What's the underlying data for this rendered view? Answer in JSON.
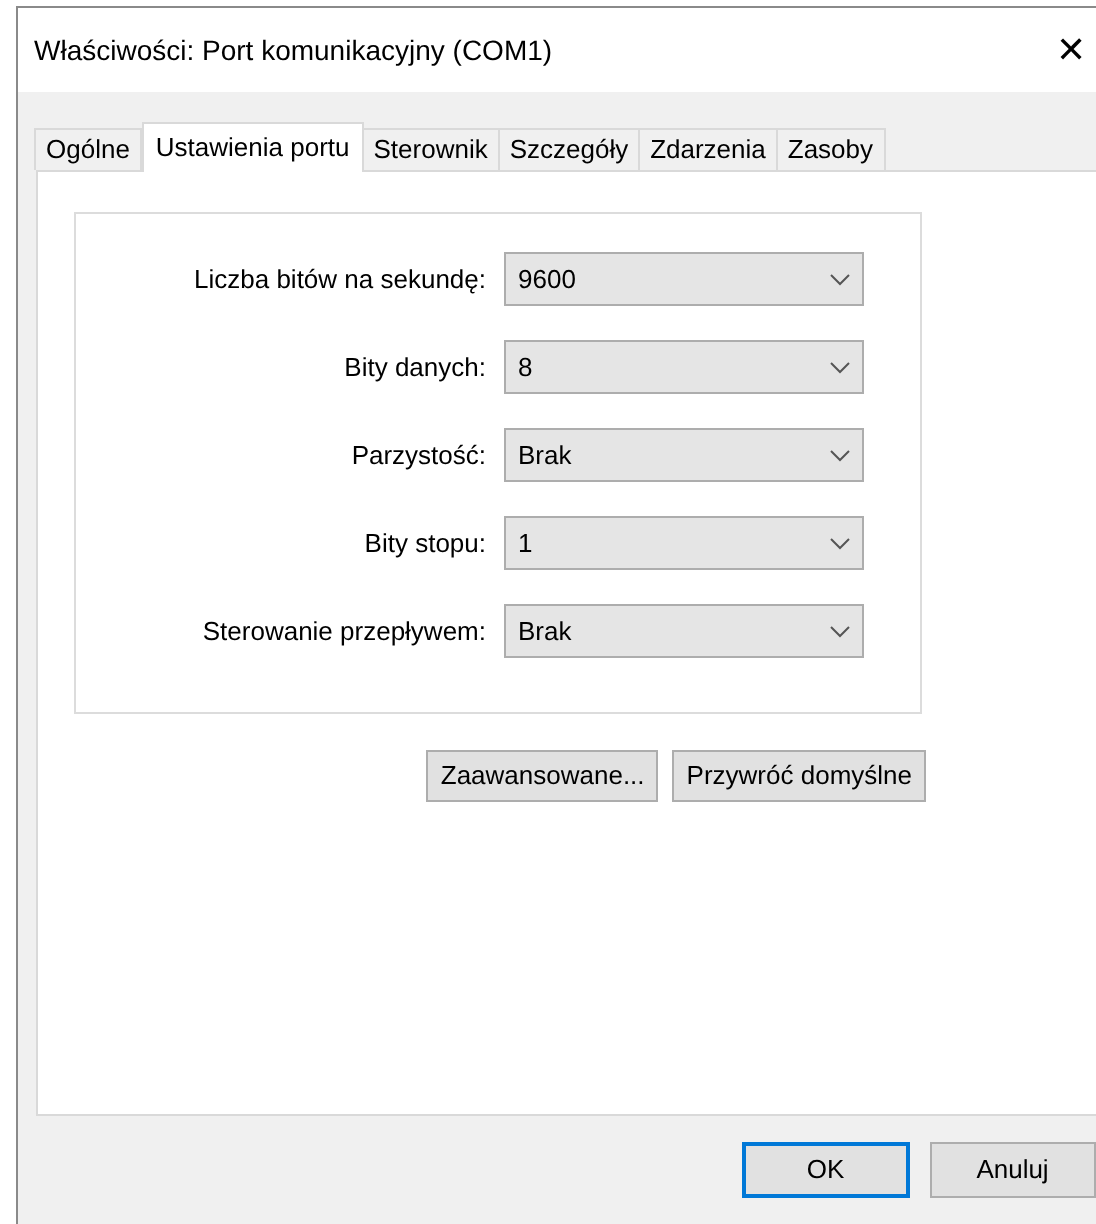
{
  "window": {
    "title": "Właściwości: Port komunikacyjny (COM1)",
    "close": "✕"
  },
  "tabs": [
    {
      "label": "Ogólne",
      "selected": false
    },
    {
      "label": "Ustawienia portu",
      "selected": true
    },
    {
      "label": "Sterownik",
      "selected": false
    },
    {
      "label": "Szczegóły",
      "selected": false
    },
    {
      "label": "Zdarzenia",
      "selected": false
    },
    {
      "label": "Zasoby",
      "selected": false
    }
  ],
  "settings": [
    {
      "label": "Liczba bitów na sekundę:",
      "value": "9600"
    },
    {
      "label": "Bity danych:",
      "value": "8"
    },
    {
      "label": "Parzystość:",
      "value": "Brak"
    },
    {
      "label": "Bity stopu:",
      "value": "1"
    },
    {
      "label": "Sterowanie przepływem:",
      "value": "Brak"
    }
  ],
  "actions": [
    "Zaawansowane...",
    "Przywróć domyślne"
  ],
  "buttons": [
    {
      "label": "OK",
      "default": true
    },
    {
      "label": "Anuluj",
      "default": false
    }
  ]
}
